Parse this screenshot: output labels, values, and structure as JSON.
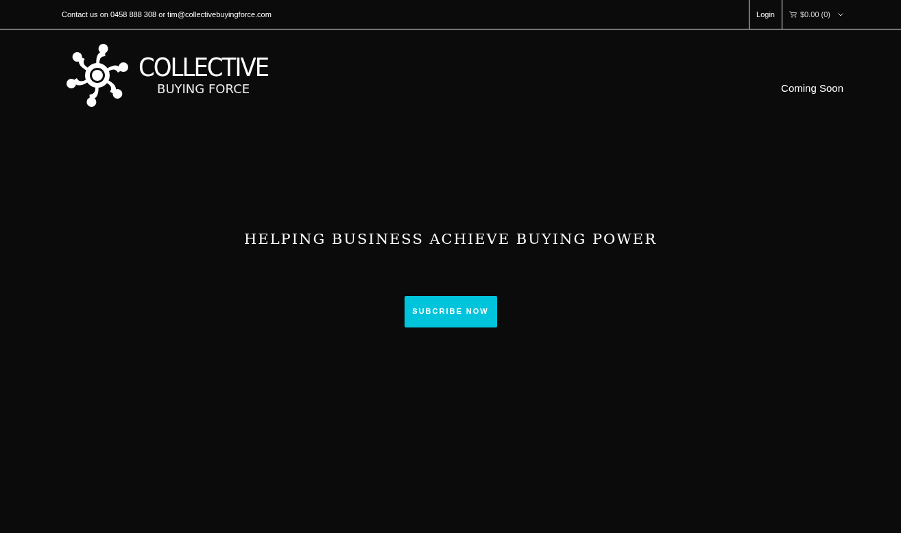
{
  "top_bar": {
    "contact": "Contact us on 0458 888 308 or tim@collectivebuyingforce.com",
    "login": "Login",
    "cart": "$0.00 (0)"
  },
  "logo": {
    "line_1": "COLLECTIVE",
    "line_2": "BUYING FORCE"
  },
  "nav": [
    "Coming Soon"
  ],
  "hero": {
    "heading": "HELPING BUSINESS ACHIEVE BUYING POWER",
    "button": "SUBCRIBE NOW"
  }
}
